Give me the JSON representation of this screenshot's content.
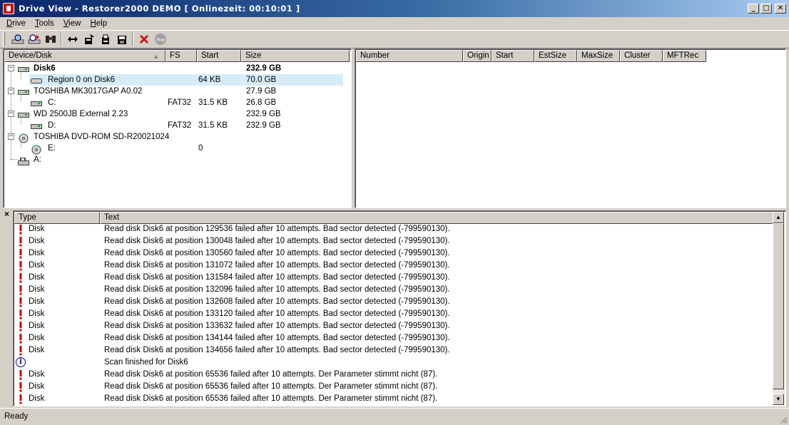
{
  "window": {
    "title": "Drive View - Restorer2000 DEMO [ Onlinezeit: 00:10:01 ]",
    "min_glyph": "_",
    "max_glyph": "□",
    "close_glyph": "✕"
  },
  "menu": [
    "Drive",
    "Tools",
    "View",
    "Help"
  ],
  "toolbar_icons": [
    "find-drive-icon",
    "scan-icon",
    "binoculars-icon",
    "arrows-icon",
    "open-icon",
    "print-icon",
    "save-icon",
    "cancel-icon",
    "stop-icon"
  ],
  "stop_label": "Stop",
  "device_tree": {
    "columns": [
      "Device/Disk",
      "FS",
      "Start",
      "Size"
    ],
    "sort_glyph": "▲",
    "rows": [
      {
        "name": "Disk6",
        "fs": "",
        "start": "",
        "size": "232.9 GB",
        "bold": true,
        "level": 0,
        "expander": "−",
        "icon": "hdd"
      },
      {
        "name": "Region 0 on Disk6",
        "fs": "",
        "start": "64 KB",
        "size": "70.0 GB",
        "bold": false,
        "level": 1,
        "expander": "",
        "icon": "region",
        "selected": true
      },
      {
        "name": "TOSHIBA MK3017GAP A0.02",
        "fs": "",
        "start": "",
        "size": "27.9 GB",
        "bold": false,
        "level": 0,
        "expander": "−",
        "icon": "hdd"
      },
      {
        "name": "C:",
        "fs": "FAT32",
        "start": "31.5 KB",
        "size": "26.8 GB",
        "bold": false,
        "level": 1,
        "expander": "",
        "icon": "hdd"
      },
      {
        "name": "WD 2500JB External 2.23",
        "fs": "",
        "start": "",
        "size": "232.9 GB",
        "bold": false,
        "level": 0,
        "expander": "−",
        "icon": "hdd"
      },
      {
        "name": "D:",
        "fs": "FAT32",
        "start": "31.5 KB",
        "size": "232.9 GB",
        "bold": false,
        "level": 1,
        "expander": "",
        "icon": "hdd"
      },
      {
        "name": "TOSHIBA DVD-ROM SD-R20021024",
        "fs": "",
        "start": "",
        "size": "",
        "bold": false,
        "level": 0,
        "expander": "−",
        "icon": "cd"
      },
      {
        "name": "E:",
        "fs": "",
        "start": "0",
        "size": "",
        "bold": false,
        "level": 1,
        "expander": "",
        "icon": "cd"
      },
      {
        "name": "A:",
        "fs": "",
        "start": "",
        "size": "",
        "bold": false,
        "level": 0,
        "expander": "",
        "icon": "floppy"
      }
    ]
  },
  "file_list": {
    "columns": [
      "Number",
      "Origin",
      "Start",
      "EstSize",
      "MaxSize",
      "Cluster",
      "MFTRec"
    ]
  },
  "log": {
    "close_glyph": "×",
    "columns": [
      "Type",
      "Text"
    ],
    "rows": [
      {
        "kind": "error",
        "type": "Disk",
        "text": "Read disk Disk6 at position 129536 failed after 10 attempts. Bad sector detected (-799590130)."
      },
      {
        "kind": "error",
        "type": "Disk",
        "text": "Read disk Disk6 at position 130048 failed after 10 attempts. Bad sector detected (-799590130)."
      },
      {
        "kind": "error",
        "type": "Disk",
        "text": "Read disk Disk6 at position 130560 failed after 10 attempts. Bad sector detected (-799590130)."
      },
      {
        "kind": "error",
        "type": "Disk",
        "text": "Read disk Disk6 at position 131072 failed after 10 attempts. Bad sector detected (-799590130)."
      },
      {
        "kind": "error",
        "type": "Disk",
        "text": "Read disk Disk6 at position 131584 failed after 10 attempts. Bad sector detected (-799590130)."
      },
      {
        "kind": "error",
        "type": "Disk",
        "text": "Read disk Disk6 at position 132096 failed after 10 attempts. Bad sector detected (-799590130)."
      },
      {
        "kind": "error",
        "type": "Disk",
        "text": "Read disk Disk6 at position 132608 failed after 10 attempts. Bad sector detected (-799590130)."
      },
      {
        "kind": "error",
        "type": "Disk",
        "text": "Read disk Disk6 at position 133120 failed after 10 attempts. Bad sector detected (-799590130)."
      },
      {
        "kind": "error",
        "type": "Disk",
        "text": "Read disk Disk6 at position 133632 failed after 10 attempts. Bad sector detected (-799590130)."
      },
      {
        "kind": "error",
        "type": "Disk",
        "text": "Read disk Disk6 at position 134144 failed after 10 attempts. Bad sector detected (-799590130)."
      },
      {
        "kind": "error",
        "type": "Disk",
        "text": "Read disk Disk6 at position 134656 failed after 10 attempts. Bad sector detected (-799590130)."
      },
      {
        "kind": "info",
        "type": "",
        "text": "Scan finished for Disk6"
      },
      {
        "kind": "error",
        "type": "Disk",
        "text": "Read disk Disk6 at position 65536 failed after 10 attempts. Der Parameter stimmt nicht (87)."
      },
      {
        "kind": "error",
        "type": "Disk",
        "text": "Read disk Disk6 at position 65536 failed after 10 attempts. Der Parameter stimmt nicht (87)."
      },
      {
        "kind": "error",
        "type": "Disk",
        "text": "Read disk Disk6 at position 65536 failed after 10 attempts. Der Parameter stimmt nicht (87)."
      }
    ]
  },
  "status": {
    "text": "Ready"
  },
  "colors": {
    "title_gradient_start": "#0a246a",
    "title_gradient_end": "#a6caf0",
    "selection": "#d6ecf8",
    "error": "#cc0000",
    "info": "#0000a0"
  }
}
